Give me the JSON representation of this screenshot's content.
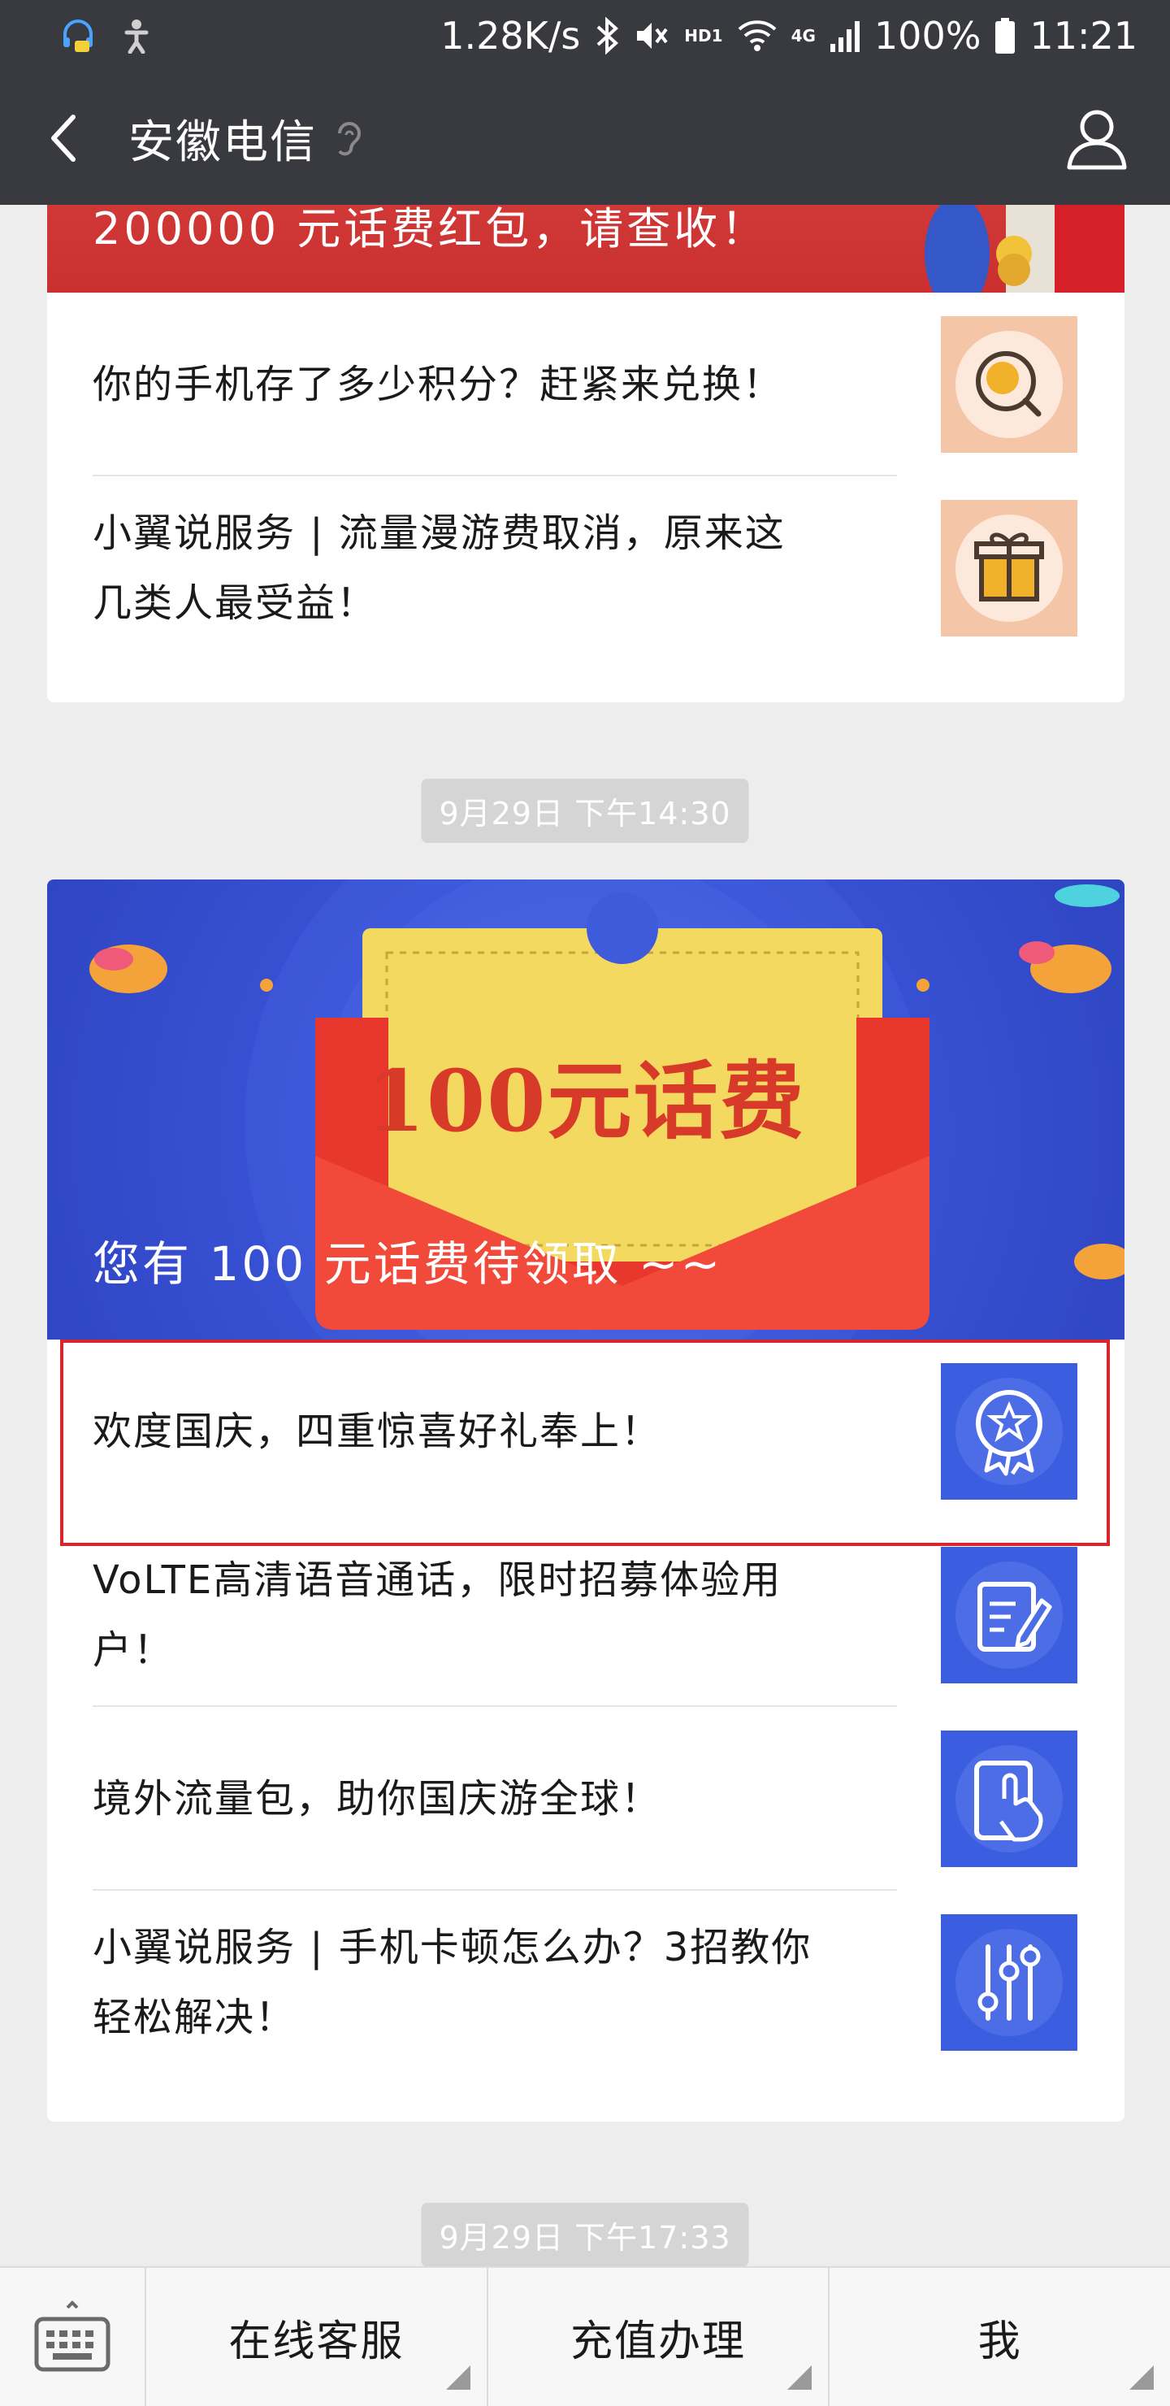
{
  "status_bar": {
    "speed": "1.28K/s",
    "hd_label": "HD1",
    "net_label": "4G",
    "battery": "100%",
    "time": "11:21"
  },
  "nav": {
    "title": "安徽电信"
  },
  "card1": {
    "banner_text": "200000 元话费红包，请查收！",
    "items": [
      {
        "title": "你的手机存了多少积分？赶紧来兑换！",
        "icon": "search-coin-icon"
      },
      {
        "title": "小翼说服务 | 流量漫游费取消，原来这几类人最受益！",
        "icon": "gift-icon"
      }
    ]
  },
  "timestamps": {
    "first": "9月29日  下午14:30",
    "second": "9月29日  下午17:33"
  },
  "card2": {
    "banner_big_text": "100元话费",
    "banner_text": "您有 100 元话费待领取 ~~",
    "items": [
      {
        "title": "欢度国庆，四重惊喜好礼奉上！",
        "icon": "badge-icon"
      },
      {
        "title": "VoLTE高清语音通话，限时招募体验用户！",
        "icon": "edit-note-icon"
      },
      {
        "title": "境外流量包，助你国庆游全球！",
        "icon": "touch-phone-icon"
      },
      {
        "title": "小翼说服务 | 手机卡顿怎么办？3招教你轻松解决！",
        "icon": "sliders-icon"
      }
    ]
  },
  "bottom_menu": {
    "items": [
      "在线客服",
      "充值办理",
      "我"
    ]
  },
  "colors": {
    "header_bg": "#393a3f",
    "highlight": "#d9252b",
    "blue_thumb": "#3b5ee0",
    "peach_thumb": "#f4c5a7"
  }
}
